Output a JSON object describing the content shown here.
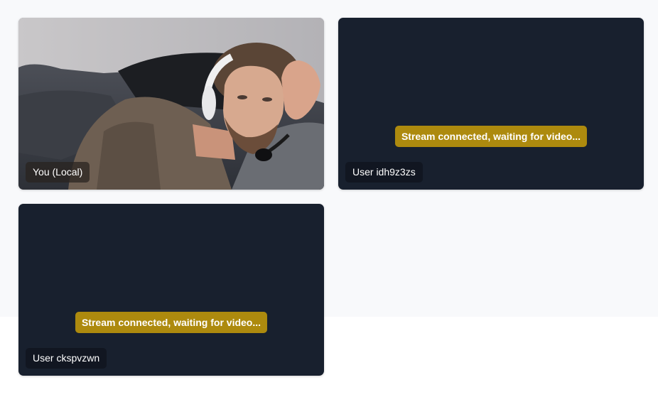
{
  "tiles": [
    {
      "label": "You (Local)",
      "kind": "local"
    },
    {
      "label": "User idh9z3zs",
      "kind": "remote",
      "status": "Stream connected, waiting for video..."
    },
    {
      "label": "User ckspvzwn",
      "kind": "remote",
      "status": "Stream connected, waiting for video..."
    }
  ],
  "colors": {
    "page_background": "#f8f9fb",
    "tile_background": "#18202e",
    "status_badge": "#ad8a0e"
  }
}
